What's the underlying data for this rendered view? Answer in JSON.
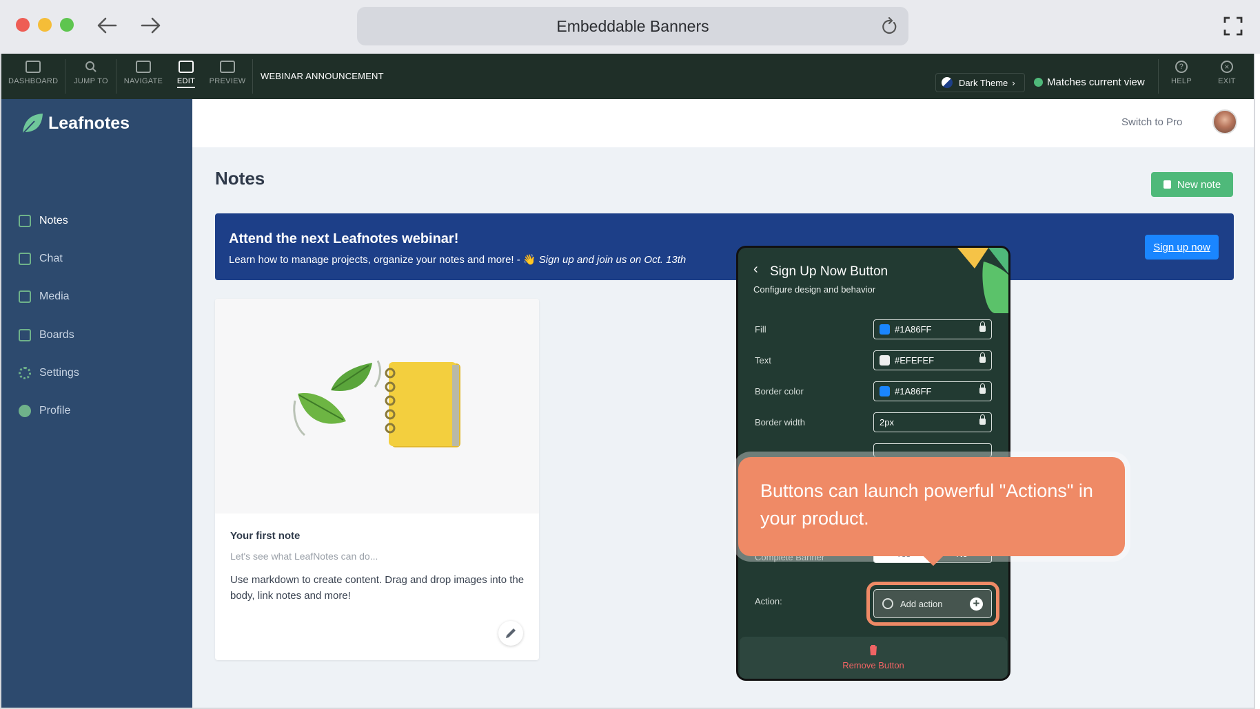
{
  "browser": {
    "title": "Embeddable Banners",
    "back_icon": "arrow-left-icon",
    "forward_icon": "arrow-right-icon",
    "reload_icon": "reload-icon",
    "fullscreen_icon": "fullscreen-icon"
  },
  "toolbar": {
    "items": [
      {
        "label": "DASHBOARD"
      },
      {
        "label": "JUMP TO"
      },
      {
        "label": "NAVIGATE"
      },
      {
        "label": "EDIT"
      },
      {
        "label": "PREVIEW"
      }
    ],
    "context_title": "WEBINAR ANNOUNCEMENT",
    "theme_label": "Dark Theme",
    "match_label": "Matches current view",
    "help_label": "HELP",
    "exit_label": "EXIT"
  },
  "app": {
    "brand": "Leafnotes",
    "nav": [
      {
        "label": "Notes"
      },
      {
        "label": "Chat"
      },
      {
        "label": "Media"
      },
      {
        "label": "Boards"
      },
      {
        "label": "Settings"
      },
      {
        "label": "Profile"
      }
    ],
    "switch_label": "Switch to Pro",
    "page_title": "Notes",
    "new_note_label": "New note"
  },
  "banner": {
    "title": "Attend the next Leafnotes webinar!",
    "body": "Learn how to manage projects, organize your notes and more! - ",
    "emoji": "👋",
    "italic": "Sign up and join us on Oct. 13th",
    "button": "Sign up now"
  },
  "note": {
    "title": "Your first note",
    "subtitle": "Let's see what LeafNotes can do...",
    "body": "Use markdown to create content. Drag and drop images into the body, link notes and more!"
  },
  "panel": {
    "title": "Sign Up Now Button",
    "subtitle": "Configure design and behavior",
    "fields": [
      {
        "label": "Fill",
        "value": "#1A86FF",
        "swatch": "#1a86ff"
      },
      {
        "label": "Text",
        "value": "#EFEFEF",
        "swatch": "#efefef"
      },
      {
        "label": "Border color",
        "value": "#1A86FF",
        "swatch": "#1a86ff"
      },
      {
        "label": "Border width",
        "value": "2px"
      }
    ],
    "complete_label": "Complete Banner",
    "yes_label": "Yes",
    "no_label": "No",
    "action_label": "Action:",
    "add_action_label": "Add action",
    "remove_label": "Remove Button"
  },
  "tooltip": {
    "text": "Buttons can launch powerful \"Actions\" in your product."
  },
  "colors": {
    "accent_green": "#4fb97a",
    "banner_blue": "#1d3f88",
    "button_blue": "#1a86ff",
    "tooltip": "#ef8a66"
  }
}
